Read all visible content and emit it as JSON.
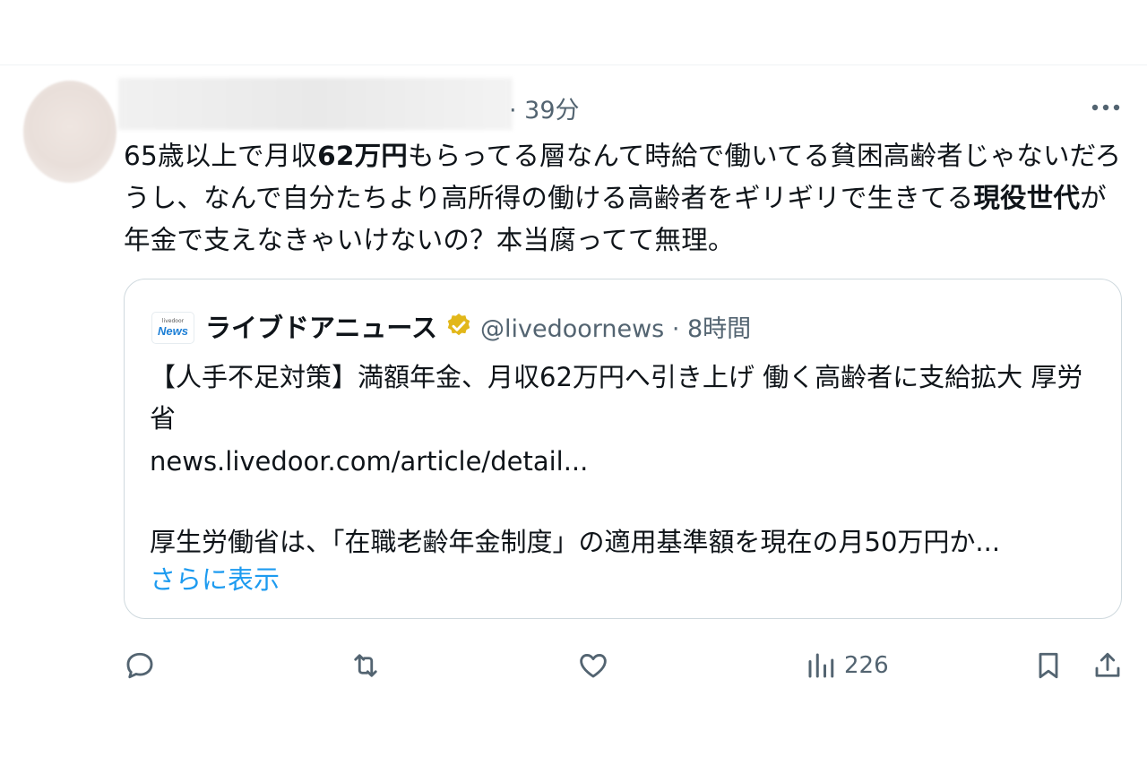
{
  "tweet": {
    "time": "· 39分",
    "text_segments": [
      {
        "text": "65歳以上で月収",
        "bold": false
      },
      {
        "text": "62万円",
        "bold": true
      },
      {
        "text": "もらってる層なんて時給で働いてる貧困高齢者じゃないだろうし、なんで自分たちより高所得の働ける高齢者をギリギリで生きてる",
        "bold": false
      },
      {
        "text": "現役世代",
        "bold": true
      },
      {
        "text": "が年金で支えなきゃいけないの？本当腐ってて無理。",
        "bold": false
      }
    ]
  },
  "quote": {
    "logo_small": "livedoor",
    "logo_big": "News",
    "name": "ライブドアニュース",
    "handle_time": "@livedoornews · 8時間",
    "headline": "【人手不足対策】満額年金、月収62万円へ引き上げ 働く高齢者に支給拡大 厚労省",
    "url": "news.livedoor.com/article/detail...",
    "description": "厚生労働省は、「在職老齢年金制度」の適用基準額を現在の月50万円か...",
    "show_more": "さらに表示"
  },
  "actions": {
    "views_count": "226"
  },
  "colors": {
    "text": "#0f1419",
    "secondary": "#536471",
    "link": "#1d9bf0",
    "border": "#cfd9de",
    "badge_gold": "#e2b719"
  }
}
